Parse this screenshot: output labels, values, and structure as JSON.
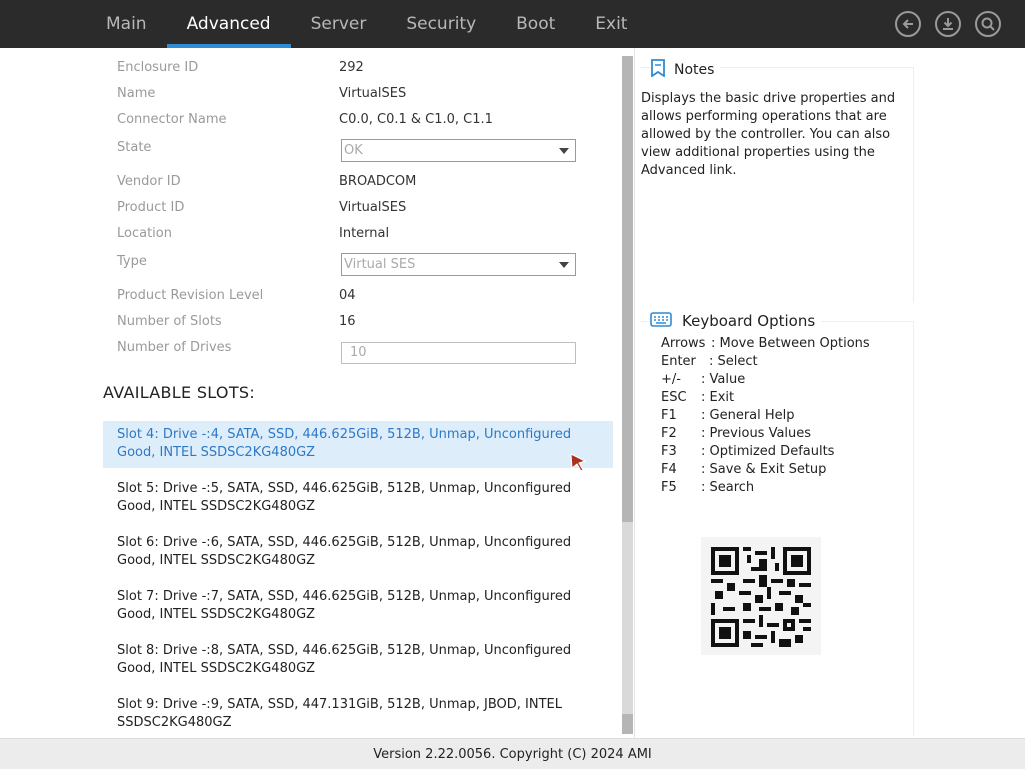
{
  "tabs": [
    {
      "label": "Main"
    },
    {
      "label": "Advanced"
    },
    {
      "label": "Server"
    },
    {
      "label": "Security"
    },
    {
      "label": "Boot"
    },
    {
      "label": "Exit"
    }
  ],
  "top_icons": [
    "back-arrow-icon",
    "download-icon",
    "search-icon"
  ],
  "properties": {
    "enclosure_id": {
      "label": "Enclosure ID",
      "value": "292"
    },
    "name": {
      "label": "Name",
      "value": "VirtualSES"
    },
    "connector_name": {
      "label": "Connector Name",
      "value": "C0.0, C0.1 & C1.0, C1.1"
    },
    "state": {
      "label": "State",
      "value": "OK"
    },
    "vendor_id": {
      "label": "Vendor ID",
      "value": "BROADCOM"
    },
    "product_id": {
      "label": "Product ID",
      "value": "VirtualSES"
    },
    "location": {
      "label": "Location",
      "value": "Internal"
    },
    "type": {
      "label": "Type",
      "value": "Virtual SES"
    },
    "product_revision_level": {
      "label": "Product Revision Level",
      "value": "04"
    },
    "number_of_slots": {
      "label": "Number of Slots",
      "value": "16"
    },
    "number_of_drives": {
      "label": "Number of Drives",
      "value": "10"
    }
  },
  "available_slots_title": "AVAILABLE SLOTS:",
  "slots": [
    {
      "text": "Slot 4: Drive -:4, SATA, SSD, 446.625GiB, 512B, Unmap, Unconfigured Good, INTEL SSDSC2KG480GZ"
    },
    {
      "text": "Slot 5: Drive -:5, SATA, SSD, 446.625GiB, 512B, Unmap, Unconfigured Good, INTEL SSDSC2KG480GZ"
    },
    {
      "text": "Slot 6: Drive -:6, SATA, SSD, 446.625GiB, 512B, Unmap, Unconfigured Good, INTEL SSDSC2KG480GZ"
    },
    {
      "text": "Slot 7: Drive -:7, SATA, SSD, 446.625GiB, 512B, Unmap, Unconfigured Good, INTEL SSDSC2KG480GZ"
    },
    {
      "text": "Slot 8: Drive -:8, SATA, SSD, 446.625GiB, 512B, Unmap, Unconfigured Good, INTEL SSDSC2KG480GZ"
    },
    {
      "text": "Slot 9: Drive -:9, SATA, SSD, 447.131GiB, 512B, Unmap, JBOD, INTEL SSDSC2KG480GZ"
    }
  ],
  "notes": {
    "title": "Notes",
    "text": "Displays the basic drive properties and allows performing operations that are allowed by the controller. You can also view additional properties using the Advanced link."
  },
  "keyboard": {
    "title": "Keyboard Options",
    "items": [
      {
        "key": "Arrows",
        "desc": ": Move Between Options"
      },
      {
        "key": "Enter",
        "desc": ": Select"
      },
      {
        "key": "+/-",
        "desc": ": Value"
      },
      {
        "key": "ESC",
        "desc": ": Exit"
      },
      {
        "key": "F1",
        "desc": ": General Help"
      },
      {
        "key": "F2",
        "desc": ": Previous Values"
      },
      {
        "key": "F3",
        "desc": ": Optimized Defaults"
      },
      {
        "key": "F4",
        "desc": ": Save & Exit Setup"
      },
      {
        "key": "F5",
        "desc": ": Search"
      }
    ]
  },
  "footer": "Version 2.22.0056. Copyright (C) 2024 AMI",
  "colors": {
    "accent": "#2e8bd6",
    "topbar": "#2b2b2b",
    "selected_row": "#ddeefa",
    "selected_text": "#2e78c9"
  }
}
